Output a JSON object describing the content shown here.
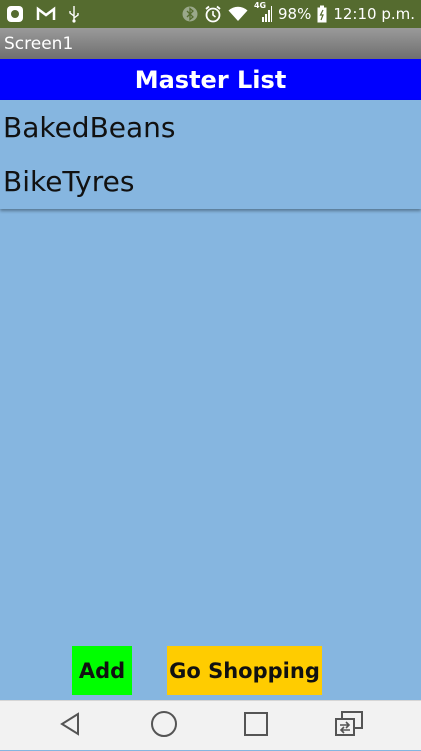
{
  "status_bar": {
    "icons_left": [
      "square-app-icon",
      "gmail-icon",
      "usb-icon"
    ],
    "icons_right": [
      "bluetooth-icon",
      "alarm-icon",
      "wifi-icon",
      "signal-4g-icon",
      "battery-icon"
    ],
    "network": "4G",
    "battery": "98%",
    "time": "12:10 p.m."
  },
  "title_bar": {
    "title": "Screen1"
  },
  "header": {
    "title": "Master List"
  },
  "list": {
    "items": [
      {
        "label": "BakedBeans"
      },
      {
        "label": "BikeTyres"
      }
    ]
  },
  "buttons": {
    "add_label": "Add",
    "shop_label": "Go Shopping"
  },
  "nav_bar": {
    "icons": [
      "back-icon",
      "home-icon",
      "recents-icon",
      "switch-app-icon"
    ]
  },
  "colors": {
    "status_bar": "#556b2f",
    "header": "#0000ff",
    "background": "#86b6e0",
    "add_button": "#00ff00",
    "shop_button": "#ffcc00"
  }
}
